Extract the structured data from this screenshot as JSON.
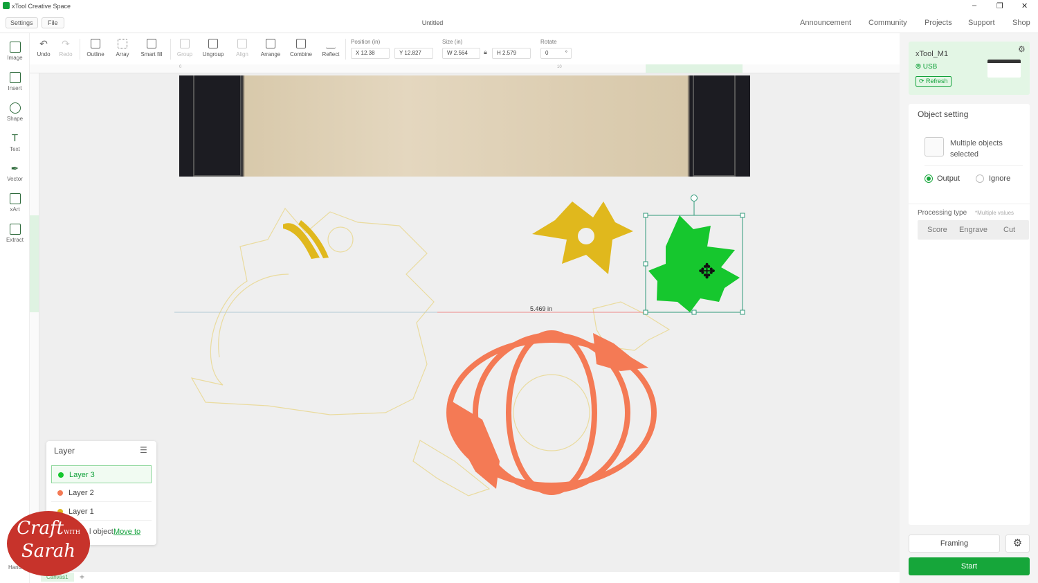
{
  "app": {
    "title": "xTool Creative Space",
    "window_controls": [
      "–",
      "❐",
      "✕"
    ]
  },
  "menubar": {
    "settings_label": "Settings",
    "file_label": "File",
    "doc_title": "Untitled",
    "nav": [
      "Announcement",
      "Community",
      "Projects",
      "Support",
      "Shop"
    ]
  },
  "left_tools": [
    {
      "label": "Image",
      "icon": "image-icon"
    },
    {
      "label": "Insert",
      "icon": "insert-icon"
    },
    {
      "label": "Shape",
      "icon": "shape-icon"
    },
    {
      "label": "Text",
      "icon": "text-icon"
    },
    {
      "label": "Vector",
      "icon": "pen-icon"
    },
    {
      "label": "xArt",
      "icon": "ai-icon"
    },
    {
      "label": "Extract",
      "icon": "extract-icon"
    }
  ],
  "left_tools_bottom": {
    "label": "Hand"
  },
  "toolbar": {
    "undo": "Undo",
    "redo": "Redo",
    "outline": "Outline",
    "array": "Array",
    "smart_fill": "Smart fill",
    "group": "Group",
    "ungroup": "Ungroup",
    "align": "Align",
    "arrange": "Arrange",
    "combine": "Combine",
    "reflect": "Reflect",
    "position_label": "Position (in)",
    "size_label": "Size (in)",
    "rotate_label": "Rotate",
    "x_value": "X 12.38",
    "y_value": "Y 12.827",
    "w_value": "W 2.564",
    "h_value": "H 2.579",
    "rotate_value": "0",
    "rotate_unit": "°"
  },
  "ruler": {
    "h_tick_0": "0",
    "h_tick_10": "10",
    "v_tick_0": "0"
  },
  "canvas": {
    "measurement_label": "5.469 in",
    "colors": {
      "layer3": "#16c72e",
      "layer2": "#f47a55",
      "layer1": "#e0b81d",
      "outline": "#eadb9e",
      "selection": "#2f9a7a"
    }
  },
  "layers": {
    "title": "Layer",
    "items": [
      {
        "label": "Layer 3",
        "color": "#16c72e",
        "active": true
      },
      {
        "label": "Layer 2",
        "color": "#f47a55",
        "active": false
      },
      {
        "label": "Layer 1",
        "color": "#e0b81d",
        "active": false
      }
    ],
    "footer_text": "l object",
    "footer_link": "Move to"
  },
  "canvas_tabs": {
    "tab": "Canvas1",
    "add": "+"
  },
  "device": {
    "name": "xTool_M1",
    "connection": "USB",
    "refresh": "Refresh"
  },
  "object_setting": {
    "title": "Object setting",
    "selection_text": "Multiple objects selected",
    "output": "Output",
    "ignore": "Ignore",
    "processing_label": "Processing type",
    "processing_note": "*Multiple values",
    "types": [
      "Score",
      "Engrave",
      "Cut"
    ]
  },
  "actions": {
    "framing": "Framing",
    "start": "Start"
  },
  "watermark": {
    "line1": "Craft",
    "with": "WITH",
    "line2": "Sarah"
  }
}
